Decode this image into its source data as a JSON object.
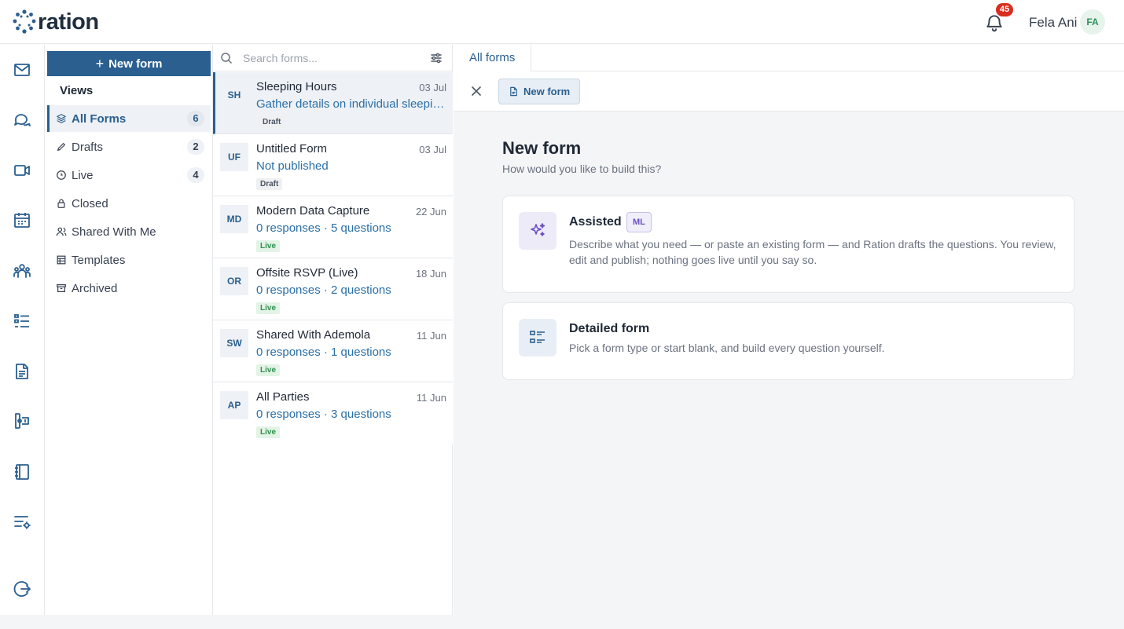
{
  "brand": {
    "name": "ration"
  },
  "header": {
    "notification_count": "45",
    "user_name": "Fela Ani",
    "user_initials": "FA"
  },
  "rail": {
    "icons": [
      "mail-icon",
      "chat-icon",
      "video-icon",
      "calendar-icon",
      "people-icon",
      "checklist-icon",
      "document-icon",
      "ticket-icon",
      "notebook-icon",
      "settings-list-icon",
      "logout-icon"
    ]
  },
  "views": {
    "new_form_label": "New form",
    "title": "Views",
    "items": [
      {
        "label": "All Forms",
        "count": "6",
        "icon": "layers-icon"
      },
      {
        "label": "Drafts",
        "count": "2",
        "icon": "pencil-icon"
      },
      {
        "label": "Live",
        "count": "4",
        "icon": "clock-icon"
      },
      {
        "label": "Closed",
        "count": "",
        "icon": "lock-icon"
      },
      {
        "label": "Shared With Me",
        "count": "",
        "icon": "users-icon"
      },
      {
        "label": "Templates",
        "count": "",
        "icon": "template-icon"
      },
      {
        "label": "Archived",
        "count": "",
        "icon": "archive-icon"
      }
    ]
  },
  "search": {
    "placeholder": "Search forms..."
  },
  "forms": [
    {
      "initials": "SH",
      "title": "Sleeping Hours",
      "date": "03 Jul",
      "subtitle": "Gather details on individual sleeping patterns",
      "status": "Draft"
    },
    {
      "initials": "UF",
      "title": "Untitled Form",
      "date": "03 Jul",
      "subtitle": "Not published",
      "status": "Draft"
    },
    {
      "initials": "MD",
      "title": "Modern Data Capture",
      "date": "22 Jun",
      "subtitle": "0 responses · 5 questions",
      "status": "Live"
    },
    {
      "initials": "OR",
      "title": "Offsite RSVP (Live)",
      "date": "18 Jun",
      "subtitle": "0 responses · 2 questions",
      "status": "Live"
    },
    {
      "initials": "SW",
      "title": "Shared With Ademola",
      "date": "11 Jun",
      "subtitle": "0 responses · 1 questions",
      "status": "Live"
    },
    {
      "initials": "AP",
      "title": "All Parties",
      "date": "11 Jun",
      "subtitle": "0 responses · 3 questions",
      "status": "Live"
    }
  ],
  "main": {
    "tab_label": "All forms",
    "doc_tab_label": "New form",
    "title": "New form",
    "subtitle": "How would you like to build this?",
    "cards": [
      {
        "title": "Assisted",
        "badge": "ML",
        "description": "Describe what you need — or paste an existing form — and Ration drafts the questions. You review, edit and publish; nothing goes live until you say so.",
        "icon": "sparkles-icon"
      },
      {
        "title": "Detailed form",
        "description": "Pick a form type or start blank, and build every question yourself.",
        "icon": "list-icon"
      }
    ]
  }
}
